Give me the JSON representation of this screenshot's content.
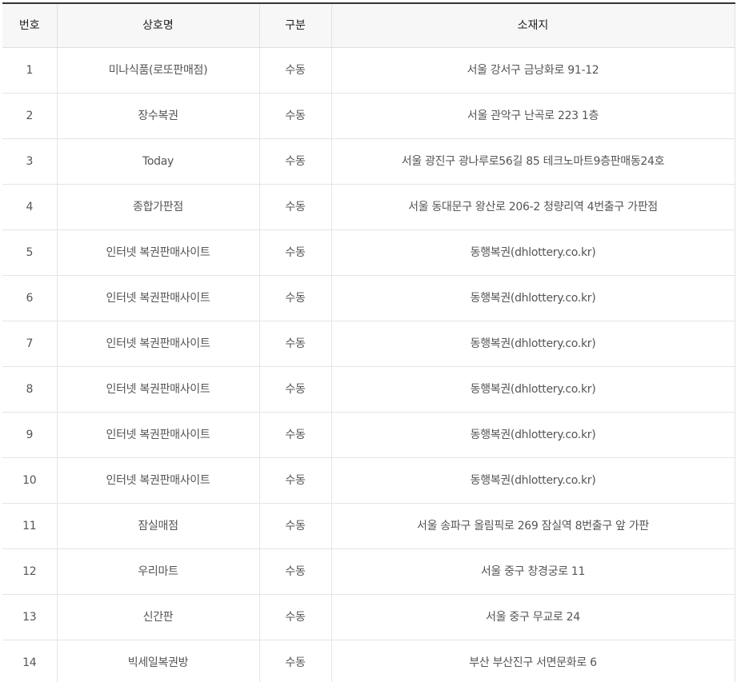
{
  "table": {
    "headers": [
      "번호",
      "상호명",
      "구분",
      "소재지"
    ],
    "rows": [
      [
        "1",
        "미나식품(로또판매점)",
        "수동",
        "서울 강서구 금낭화로 91-12"
      ],
      [
        "2",
        "장수복권",
        "수동",
        "서울 관악구 난곡로 223 1층"
      ],
      [
        "3",
        "Today",
        "수동",
        "서울 광진구 광나루로56길 85 테크노마트9층판매동24호"
      ],
      [
        "4",
        "종합가판점",
        "수동",
        "서울 동대문구 왕산로 206-2 청량리역 4번출구 가판점"
      ],
      [
        "5",
        "인터넷 복권판매사이트",
        "수동",
        "동행복권(dhlottery.co.kr)"
      ],
      [
        "6",
        "인터넷 복권판매사이트",
        "수동",
        "동행복권(dhlottery.co.kr)"
      ],
      [
        "7",
        "인터넷 복권판매사이트",
        "수동",
        "동행복권(dhlottery.co.kr)"
      ],
      [
        "8",
        "인터넷 복권판매사이트",
        "수동",
        "동행복권(dhlottery.co.kr)"
      ],
      [
        "9",
        "인터넷 복권판매사이트",
        "수동",
        "동행복권(dhlottery.co.kr)"
      ],
      [
        "10",
        "인터넷 복권판매사이트",
        "수동",
        "동행복권(dhlottery.co.kr)"
      ],
      [
        "11",
        "잠실매점",
        "수동",
        "서울 송파구 올림픽로 269 잠실역 8번출구 앞 가판"
      ],
      [
        "12",
        "우리마트",
        "수동",
        "서울 중구 창경궁로 11"
      ],
      [
        "13",
        "신간판",
        "수동",
        "서울 중구 무교로 24"
      ],
      [
        "14",
        "빅세일복권방",
        "수동",
        "부산 부산진구 서면문화로 6"
      ]
    ]
  }
}
